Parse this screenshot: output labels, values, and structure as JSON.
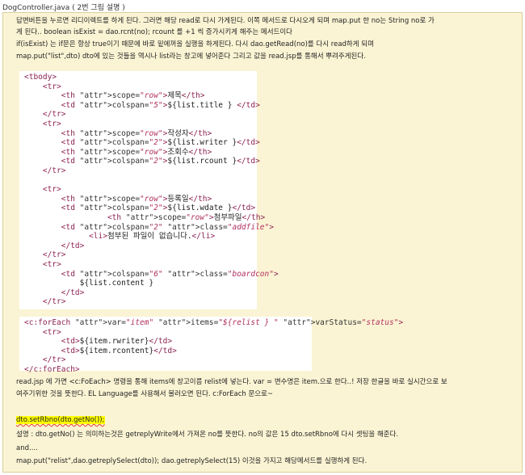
{
  "window": {
    "file_name": "DogController.java",
    "title_suffix": "( 2번 그림 설명 )"
  },
  "intro_lines": [
    "답변버튼을 누르면 리디이렉트를 하게 된다. 그러면 해당 read로 다시 가게된다. 이쪽 메서드로 다시오게 되며 map.put 한 no는 String no로 가",
    "게 된다.. boolean isExist = dao.rcnt(no);  rcount 를 +1 씩 증가시키게 해주는 메서드이다",
    "if(isExist) 는 if문은 항상 true이기 때문에 바로 밑에꺼을 실행을 하게된다. 다시 dao.getRead(no)를 다시 read하게 되며",
    "map.put(\"list\",dto) dto에 있는 것들을 역시나 list라는 창고에 넣어준다 그리고 값을 read.jsp를 통해서 뿌려주게된다."
  ],
  "code1": [
    "<tbody>",
    "    <tr>",
    "        <th scope=\"row\">제목</th>",
    "        <td colspan=\"5\">${list.title } </td>",
    "    </tr>",
    "    <tr>",
    "        <th scope=\"row\">작성자</th>",
    "        <td colspan=\"2\">${list.writer }</td>",
    "        <th scope=\"row\">조회수</th>",
    "        <td colspan=\"2\">${list.rcount }</td>",
    "    </tr>",
    "",
    "    <tr>",
    "        <th scope=\"row\">등록일</th>",
    "        <td colspan=\"2\">${list.wdate }</td>",
    "                  <th scope=\"row\">첨부파일</th>",
    "        <td colspan=\"2\" class=\"addfile\">",
    "              <li>첨부된 파일이 없습니다.</li>",
    "        </td>",
    "    </tr>",
    "    <tr>",
    "        <td colspan=\"6\" class=\"boardcon\">",
    "            ${list.content }",
    "        </td>",
    "    </tr>"
  ],
  "code2": [
    "<c:forEach var=\"item\" items=\"${relist } \" varStatus=\"status\">",
    "    <tr>",
    "        <td>${item.rwriter}</td>",
    "        <td>${item.rcontent}</td>",
    "    </tr>",
    "</c:forEach>"
  ],
  "after_lines": [
    "read.jsp 에 가면 <c:FoEach> 명령을 통해 items에 창고이름 relist에 넣는다. var = 변수명은 item.으로 한다..! 저장 한글을 바로 실시간으로 보",
    "여주기위한 것을 뜻한다. EL Language를 사용해서 불러오면 된다. c:ForEach 문으로~"
  ],
  "highlight_line": "dto.setRbno(dto.getNo());",
  "bottom_lines": [
    "설명 : dto.getNo() 는 의미하는것은  getreplyWrite에서 가져온 no를 뜻한다. no의 값은 15 dto.setRbno에 다시 셋팅을 해준다.",
    "and....",
    "map.put(\"relist\",dao.getreplySelect(dto));  dao.getreplySelect(15) 이것을 가지고 해당메서드를 실행하게 된다."
  ],
  "colors": {
    "note_background": "#fbf4d4",
    "note_border": "#d9cf9e",
    "highlight": "#ffff00",
    "spellcheck": "#e53935"
  }
}
